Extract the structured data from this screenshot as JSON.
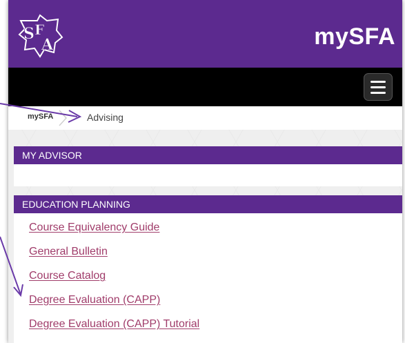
{
  "header": {
    "brand": "mySFA",
    "logo_text": "SFA"
  },
  "breadcrumb": {
    "home": "mySFA",
    "current": "Advising"
  },
  "sections": [
    {
      "title": "MY ADVISOR",
      "links": []
    },
    {
      "title": "EDUCATION PLANNING",
      "links": [
        "Course Equivalency Guide",
        "General Bulletin",
        "Course Catalog",
        "Degree Evaluation (CAPP)",
        "Degree Evaluation (CAPP) Tutorial"
      ]
    }
  ],
  "colors": {
    "brand_purple": "#5c2a8f",
    "link": "#a03c6a",
    "annotation": "#6a3aa8"
  }
}
